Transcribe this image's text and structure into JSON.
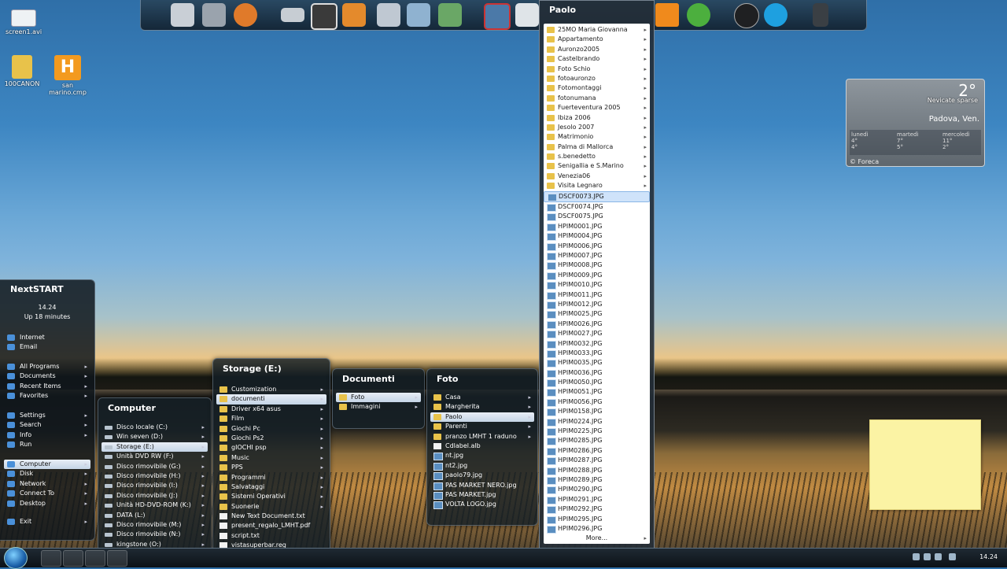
{
  "desktop_icons": [
    {
      "label": "screen1.avi",
      "icon": "video-file-icon"
    },
    {
      "label": "100CANON",
      "icon": "folder-icon"
    },
    {
      "label": "san marino.cmp",
      "icon": "app-h-icon"
    }
  ],
  "dock_icons": [
    "control-panel-icon",
    "tools-icon",
    "games-icon",
    "drive-icon",
    "photos-icon",
    "photo-gallery-icon",
    "music-icon",
    "user-download-icon",
    "network-user-icon",
    "remote-desktop-icon",
    "eject-icon",
    "vlc-icon",
    "utorrent-icon",
    "steam-icon",
    "skype-icon",
    "recycle-bin-icon"
  ],
  "paolo": {
    "title": "Paolo",
    "items": [
      {
        "label": "25MO Maria Giovanna",
        "type": "folder",
        "arrow": true
      },
      {
        "label": "Appartamento",
        "type": "folder",
        "arrow": true
      },
      {
        "label": "Auronzo2005",
        "type": "folder",
        "arrow": true
      },
      {
        "label": "Castelbrando",
        "type": "folder",
        "arrow": true
      },
      {
        "label": "Foto Schio",
        "type": "folder",
        "arrow": true
      },
      {
        "label": "fotoauronzo",
        "type": "folder",
        "arrow": true
      },
      {
        "label": "Fotomontaggi",
        "type": "folder",
        "arrow": true
      },
      {
        "label": "fotonumana",
        "type": "folder",
        "arrow": true
      },
      {
        "label": "Fuerteventura 2005",
        "type": "folder",
        "arrow": true
      },
      {
        "label": "Ibiza 2006",
        "type": "folder",
        "arrow": true
      },
      {
        "label": "Jesolo 2007",
        "type": "folder",
        "arrow": true
      },
      {
        "label": "Matrimonio",
        "type": "folder",
        "arrow": true
      },
      {
        "label": "Palma di Mallorca",
        "type": "folder",
        "arrow": true
      },
      {
        "label": "s.benedetto",
        "type": "folder",
        "arrow": true
      },
      {
        "label": "Senigallia e S.Marino",
        "type": "folder",
        "arrow": true
      },
      {
        "label": "Venezia06",
        "type": "folder",
        "arrow": true
      },
      {
        "label": "Visita Legnaro",
        "type": "folder",
        "arrow": true
      },
      {
        "label": "DSCF0073.JPG",
        "type": "image",
        "selected": true
      },
      {
        "label": "DSCF0074.JPG",
        "type": "image"
      },
      {
        "label": "DSCF0075.JPG",
        "type": "image"
      },
      {
        "label": "HPIM0001.JPG",
        "type": "image"
      },
      {
        "label": "HPIM0004.JPG",
        "type": "image"
      },
      {
        "label": "HPIM0006.JPG",
        "type": "image"
      },
      {
        "label": "HPIM0007.JPG",
        "type": "image"
      },
      {
        "label": "HPIM0008.JPG",
        "type": "image"
      },
      {
        "label": "HPIM0009.JPG",
        "type": "image"
      },
      {
        "label": "HPIM0010.JPG",
        "type": "image"
      },
      {
        "label": "HPIM0011.JPG",
        "type": "image"
      },
      {
        "label": "HPIM0012.JPG",
        "type": "image"
      },
      {
        "label": "HPIM0025.JPG",
        "type": "image"
      },
      {
        "label": "HPIM0026.JPG",
        "type": "image"
      },
      {
        "label": "HPIM0027.JPG",
        "type": "image"
      },
      {
        "label": "HPIM0032.JPG",
        "type": "image"
      },
      {
        "label": "HPIM0033.JPG",
        "type": "image"
      },
      {
        "label": "HPIM0035.JPG",
        "type": "image"
      },
      {
        "label": "HPIM0036.JPG",
        "type": "image"
      },
      {
        "label": "HPIM0050.JPG",
        "type": "image"
      },
      {
        "label": "HPIM0051.JPG",
        "type": "image"
      },
      {
        "label": "HPIM0056.JPG",
        "type": "image"
      },
      {
        "label": "HPIM0158.JPG",
        "type": "image"
      },
      {
        "label": "HPIM0224.JPG",
        "type": "image"
      },
      {
        "label": "HPIM0225.JPG",
        "type": "image"
      },
      {
        "label": "HPIM0285.JPG",
        "type": "image"
      },
      {
        "label": "HPIM0286.JPG",
        "type": "image"
      },
      {
        "label": "HPIM0287.JPG",
        "type": "image"
      },
      {
        "label": "HPIM0288.JPG",
        "type": "image"
      },
      {
        "label": "HPIM0289.JPG",
        "type": "image"
      },
      {
        "label": "HPIM0290.JPG",
        "type": "image"
      },
      {
        "label": "HPIM0291.JPG",
        "type": "image"
      },
      {
        "label": "HPIM0292.JPG",
        "type": "image"
      },
      {
        "label": "HPIM0295.JPG",
        "type": "image"
      },
      {
        "label": "HPIM0296.JPG",
        "type": "image"
      }
    ],
    "more": "More..."
  },
  "foto": {
    "title": "Foto",
    "items": [
      {
        "label": "Casa",
        "type": "folder",
        "arrow": true
      },
      {
        "label": "Margherita",
        "type": "folder",
        "arrow": true
      },
      {
        "label": "Paolo",
        "type": "folder",
        "arrow": true,
        "selected": true
      },
      {
        "label": "Parenti",
        "type": "folder",
        "arrow": true
      },
      {
        "label": "pranzo LMHT 1 raduno",
        "type": "folder",
        "arrow": true
      },
      {
        "label": "Cdlabel.alb",
        "type": "doc"
      },
      {
        "label": "nt.jpg",
        "type": "image"
      },
      {
        "label": "nt2.jpg",
        "type": "image"
      },
      {
        "label": "paolo79.jpg",
        "type": "image"
      },
      {
        "label": "PAS MARKET NERO.jpg",
        "type": "image"
      },
      {
        "label": "PAS MARKET.jpg",
        "type": "image"
      },
      {
        "label": "VOLTA LOGO.jpg",
        "type": "image"
      }
    ]
  },
  "documenti": {
    "title": "Documenti",
    "items": [
      {
        "label": "Foto",
        "type": "folder",
        "arrow": true,
        "selected": true
      },
      {
        "label": "Immagini",
        "type": "folder",
        "arrow": true
      }
    ]
  },
  "storage": {
    "title": "Storage (E:)",
    "items": [
      {
        "label": "Customization",
        "type": "folder",
        "arrow": true
      },
      {
        "label": "documenti",
        "type": "folder",
        "arrow": true,
        "selected": true
      },
      {
        "label": "Driver x64 asus",
        "type": "folder",
        "arrow": true
      },
      {
        "label": "Film",
        "type": "folder",
        "arrow": true
      },
      {
        "label": "Giochi Pc",
        "type": "folder",
        "arrow": true
      },
      {
        "label": "Giochi Ps2",
        "type": "folder",
        "arrow": true
      },
      {
        "label": "gIOCHI psp",
        "type": "folder",
        "arrow": true
      },
      {
        "label": "Music",
        "type": "folder",
        "arrow": true
      },
      {
        "label": "PPS",
        "type": "folder",
        "arrow": true
      },
      {
        "label": "Programmi",
        "type": "folder",
        "arrow": true
      },
      {
        "label": "Salvataggi",
        "type": "folder",
        "arrow": true
      },
      {
        "label": "Sistemi Operativi",
        "type": "folder",
        "arrow": true
      },
      {
        "label": "Suonerie",
        "type": "folder",
        "arrow": true
      },
      {
        "label": "New Text Document.txt",
        "type": "doc"
      },
      {
        "label": "present_regalo_LMHT.pdf",
        "type": "doc"
      },
      {
        "label": "script.txt",
        "type": "doc"
      },
      {
        "label": "vistasuperbar.reg",
        "type": "doc"
      }
    ]
  },
  "computer": {
    "title": "Computer",
    "items": [
      {
        "label": "Disco locale (C:)",
        "type": "drive",
        "arrow": true
      },
      {
        "label": "Win seven (D:)",
        "type": "drive",
        "arrow": true
      },
      {
        "label": "Storage (E:)",
        "type": "drive",
        "arrow": true,
        "selected": true
      },
      {
        "label": "Unità DVD RW (F:)",
        "type": "drive",
        "arrow": true
      },
      {
        "label": "Disco rimovibile (G:)",
        "type": "drive",
        "arrow": true
      },
      {
        "label": "Disco rimovibile (H:)",
        "type": "drive",
        "arrow": true
      },
      {
        "label": "Disco rimovibile (I:)",
        "type": "drive",
        "arrow": true
      },
      {
        "label": "Disco rimovibile (J:)",
        "type": "drive",
        "arrow": true
      },
      {
        "label": "Unità HD-DVD-ROM (K:)",
        "type": "drive",
        "arrow": true
      },
      {
        "label": "DATA (L:)",
        "type": "drive",
        "arrow": true
      },
      {
        "label": "Disco rimovibile (M:)",
        "type": "drive",
        "arrow": true
      },
      {
        "label": "Disco rimovibile (N:)",
        "type": "drive",
        "arrow": true
      },
      {
        "label": "kingstone (O:)",
        "type": "drive",
        "arrow": true
      }
    ]
  },
  "nextstart": {
    "title": "NextSTART",
    "time": "14.24",
    "uptime": "Up 18 minutes",
    "group1": [
      {
        "label": "Internet"
      },
      {
        "label": "Email"
      }
    ],
    "group2": [
      {
        "label": "All Programs",
        "arrow": true
      },
      {
        "label": "Documents",
        "arrow": true
      },
      {
        "label": "Recent Items",
        "arrow": true
      },
      {
        "label": "Favorites",
        "arrow": true
      }
    ],
    "group3": [
      {
        "label": "Settings",
        "arrow": true
      },
      {
        "label": "Search",
        "arrow": true
      },
      {
        "label": "Info",
        "arrow": true
      },
      {
        "label": "Run"
      }
    ],
    "group4": [
      {
        "label": "Computer",
        "arrow": true,
        "selected": true
      },
      {
        "label": "Disk",
        "arrow": true
      },
      {
        "label": "Network",
        "arrow": true
      },
      {
        "label": "Connect To",
        "arrow": true
      },
      {
        "label": "Desktop",
        "arrow": true
      }
    ],
    "group5": [
      {
        "label": "Exit",
        "arrow": true
      }
    ]
  },
  "weather": {
    "temp": "2°",
    "condition": "Nevicate sparse",
    "city": "Padova, Ven.",
    "days": [
      {
        "name": "lunedì",
        "high": "4°",
        "low": "4°"
      },
      {
        "name": "martedì",
        "high": "7°",
        "low": "5°"
      },
      {
        "name": "mercoledì",
        "high": "11°",
        "low": "2°"
      }
    ],
    "brand": "© Foreca"
  },
  "taskbar": {
    "clock": "14.24"
  }
}
